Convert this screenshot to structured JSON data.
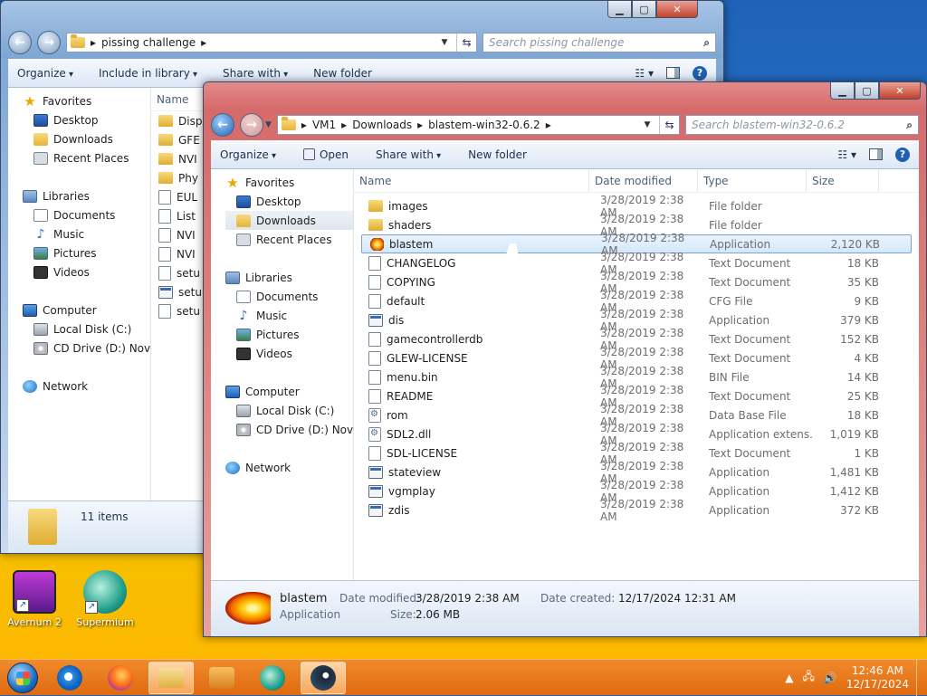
{
  "desktop": {
    "icons": [
      {
        "label": "Avernum 2"
      },
      {
        "label": "Supermium"
      }
    ]
  },
  "back_window": {
    "address": {
      "segments": [
        "pissing challenge"
      ]
    },
    "search_placeholder": "Search pissing challenge",
    "toolbar": {
      "organize": "Organize",
      "include": "Include in library",
      "share": "Share with",
      "new_folder": "New folder"
    },
    "nav": {
      "favorites": "Favorites",
      "desktop": "Desktop",
      "downloads": "Downloads",
      "recent": "Recent Places",
      "libraries": "Libraries",
      "documents": "Documents",
      "music": "Music",
      "pictures": "Pictures",
      "videos": "Videos",
      "computer": "Computer",
      "local_disk": "Local Disk (C:)",
      "cd_drive": "CD Drive (D:) Novide",
      "network": "Network"
    },
    "column_name": "Name",
    "files": [
      "Disp",
      "GFE",
      "NVI",
      "Phy",
      "EUL",
      "List",
      "NVI",
      "NVI",
      "setu",
      "setu",
      "setu"
    ],
    "status": "11 items"
  },
  "front_window": {
    "address": {
      "segments": [
        "VM1",
        "Downloads",
        "blastem-win32-0.6.2"
      ]
    },
    "search_placeholder": "Search blastem-win32-0.6.2",
    "toolbar": {
      "organize": "Organize",
      "open": "Open",
      "share": "Share with",
      "new_folder": "New folder"
    },
    "nav": {
      "favorites": "Favorites",
      "desktop": "Desktop",
      "downloads": "Downloads",
      "recent": "Recent Places",
      "libraries": "Libraries",
      "documents": "Documents",
      "music": "Music",
      "pictures": "Pictures",
      "videos": "Videos",
      "computer": "Computer",
      "local_disk": "Local Disk (C:)",
      "cd_drive": "CD Drive (D:) Novide",
      "network": "Network"
    },
    "columns": {
      "name": "Name",
      "date": "Date modified",
      "type": "Type",
      "size": "Size"
    },
    "files": [
      {
        "name": "images",
        "date": "3/28/2019 2:38 AM",
        "type": "File folder",
        "size": "",
        "icon": "folder"
      },
      {
        "name": "shaders",
        "date": "3/28/2019 2:38 AM",
        "type": "File folder",
        "size": "",
        "icon": "folder"
      },
      {
        "name": "blastem",
        "date": "3/28/2019 2:38 AM",
        "type": "Application",
        "size": "2,120 KB",
        "icon": "blastem"
      },
      {
        "name": "CHANGELOG",
        "date": "3/28/2019 2:38 AM",
        "type": "Text Document",
        "size": "18 KB",
        "icon": "doc"
      },
      {
        "name": "COPYING",
        "date": "3/28/2019 2:38 AM",
        "type": "Text Document",
        "size": "35 KB",
        "icon": "doc"
      },
      {
        "name": "default",
        "date": "3/28/2019 2:38 AM",
        "type": "CFG File",
        "size": "9 KB",
        "icon": "doc"
      },
      {
        "name": "dis",
        "date": "3/28/2019 2:38 AM",
        "type": "Application",
        "size": "379 KB",
        "icon": "app"
      },
      {
        "name": "gamecontrollerdb",
        "date": "3/28/2019 2:38 AM",
        "type": "Text Document",
        "size": "152 KB",
        "icon": "doc"
      },
      {
        "name": "GLEW-LICENSE",
        "date": "3/28/2019 2:38 AM",
        "type": "Text Document",
        "size": "4 KB",
        "icon": "doc"
      },
      {
        "name": "menu.bin",
        "date": "3/28/2019 2:38 AM",
        "type": "BIN File",
        "size": "14 KB",
        "icon": "doc"
      },
      {
        "name": "README",
        "date": "3/28/2019 2:38 AM",
        "type": "Text Document",
        "size": "25 KB",
        "icon": "doc"
      },
      {
        "name": "rom",
        "date": "3/28/2019 2:38 AM",
        "type": "Data Base File",
        "size": "18 KB",
        "icon": "gear"
      },
      {
        "name": "SDL2.dll",
        "date": "3/28/2019 2:38 AM",
        "type": "Application extens...",
        "size": "1,019 KB",
        "icon": "gear"
      },
      {
        "name": "SDL-LICENSE",
        "date": "3/28/2019 2:38 AM",
        "type": "Text Document",
        "size": "1 KB",
        "icon": "doc"
      },
      {
        "name": "stateview",
        "date": "3/28/2019 2:38 AM",
        "type": "Application",
        "size": "1,481 KB",
        "icon": "app"
      },
      {
        "name": "vgmplay",
        "date": "3/28/2019 2:38 AM",
        "type": "Application",
        "size": "1,412 KB",
        "icon": "app"
      },
      {
        "name": "zdis",
        "date": "3/28/2019 2:38 AM",
        "type": "Application",
        "size": "372 KB",
        "icon": "app"
      }
    ],
    "selected_index": 2,
    "details": {
      "name": "blastem",
      "type": "Application",
      "date_modified_label": "Date modified:",
      "date_modified": "3/28/2019 2:38 AM",
      "date_created_label": "Date created:",
      "date_created": "12/17/2024 12:31 AM",
      "size_label": "Size:",
      "size": "2.06 MB"
    }
  },
  "taskbar": {
    "time": "12:46 AM",
    "date": "12/17/2024"
  },
  "colors": {
    "taskbar": "#e8781e",
    "selection": "#d4e8fc",
    "front_frame": "#d66a6a",
    "back_frame": "#7ea7d6"
  }
}
